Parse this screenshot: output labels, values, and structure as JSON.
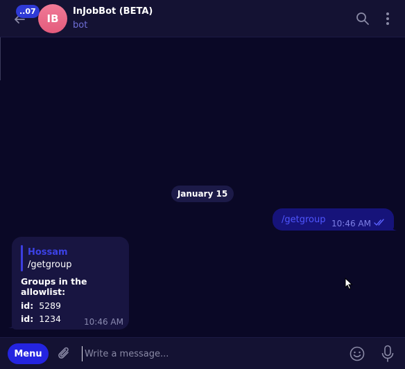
{
  "header": {
    "unread_badge": "..07",
    "avatar_initials": "IB",
    "title": "InJobBot (BETA)",
    "subtitle": "bot",
    "icons": [
      "back-arrow-icon",
      "search-icon",
      "more-vertical-icon"
    ]
  },
  "chat": {
    "date_chip": "January 15",
    "messages": [
      {
        "direction": "outgoing",
        "text": "/getgroup",
        "time": "10:46 AM",
        "status": "read"
      },
      {
        "direction": "incoming",
        "reply_to": {
          "name": "Hossam",
          "text": "/getgroup"
        },
        "heading": "Groups in the allowlist:",
        "ids": [
          {
            "key": "id:",
            "value": "5289"
          },
          {
            "key": "id:",
            "value": "1234"
          }
        ],
        "time": "10:46 AM"
      }
    ]
  },
  "composer": {
    "menu_label": "Menu",
    "placeholder": "Write a message...",
    "icons": [
      "attach-icon",
      "emoji-icon",
      "microphone-icon"
    ]
  },
  "colors": {
    "background": "#0a0826",
    "header": "#141233",
    "accent": "#2424e0",
    "outgoing_bubble": "#16137a",
    "incoming_bubble": "#181541",
    "avatar": "#e45b7c"
  }
}
